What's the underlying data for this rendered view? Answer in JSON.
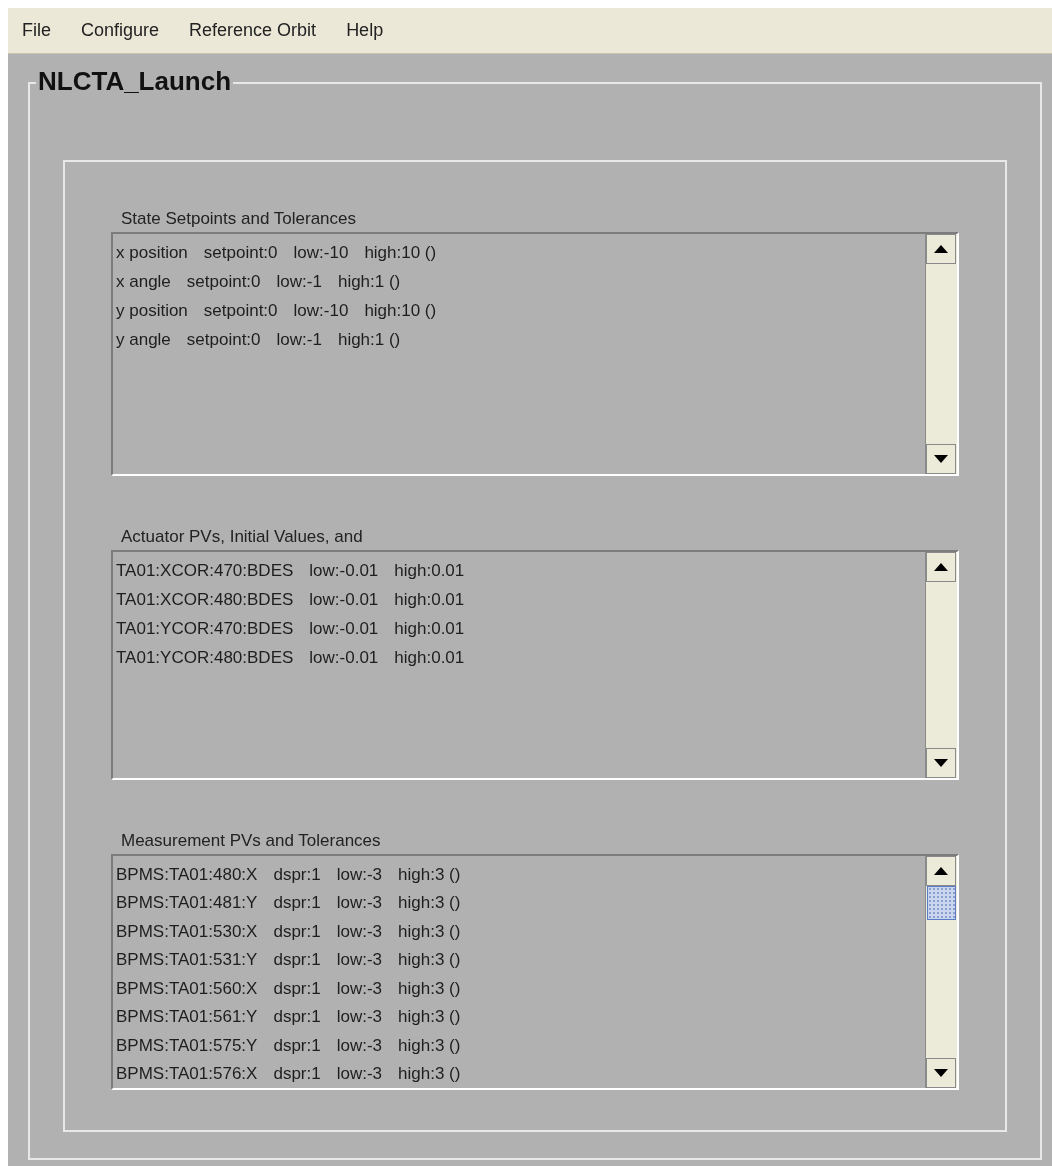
{
  "menu": [
    "File",
    "Configure",
    "Reference Orbit",
    "Help"
  ],
  "panel": {
    "title": "NLCTA_Launch"
  },
  "sections": [
    {
      "label": "State Setpoints and Tolerances",
      "rows": [
        [
          "x position",
          "setpoint:0",
          "low:-10",
          "high:10 ()"
        ],
        [
          "x angle",
          "setpoint:0",
          "low:-1",
          "high:1 ()"
        ],
        [
          "y position",
          "setpoint:0",
          "low:-10",
          "high:10 ()"
        ],
        [
          "y angle",
          "setpoint:0",
          "low:-1",
          "high:1 ()"
        ]
      ]
    },
    {
      "label": "Actuator PVs, Initial Values, and",
      "rows": [
        [
          "TA01:XCOR:470:BDES",
          "low:-0.01",
          "high:0.01"
        ],
        [
          "TA01:XCOR:480:BDES",
          "low:-0.01",
          "high:0.01"
        ],
        [
          "TA01:YCOR:470:BDES",
          "low:-0.01",
          "high:0.01"
        ],
        [
          "TA01:YCOR:480:BDES",
          "low:-0.01",
          "high:0.01"
        ]
      ]
    },
    {
      "label": "Measurement PVs and Tolerances",
      "rows": [
        [
          "BPMS:TA01:480:X",
          "dspr:1",
          "low:-3",
          "high:3 ()"
        ],
        [
          "BPMS:TA01:481:Y",
          "dspr:1",
          "low:-3",
          "high:3 ()"
        ],
        [
          "BPMS:TA01:530:X",
          "dspr:1",
          "low:-3",
          "high:3 ()"
        ],
        [
          "BPMS:TA01:531:Y",
          "dspr:1",
          "low:-3",
          "high:3 ()"
        ],
        [
          "BPMS:TA01:560:X",
          "dspr:1",
          "low:-3",
          "high:3 ()"
        ],
        [
          "BPMS:TA01:561:Y",
          "dspr:1",
          "low:-3",
          "high:3 ()"
        ],
        [
          "BPMS:TA01:575:Y",
          "dspr:1",
          "low:-3",
          "high:3 ()"
        ],
        [
          "BPMS:TA01:576:X",
          "dspr:1",
          "low:-3",
          "high:3 ()"
        ]
      ]
    }
  ]
}
